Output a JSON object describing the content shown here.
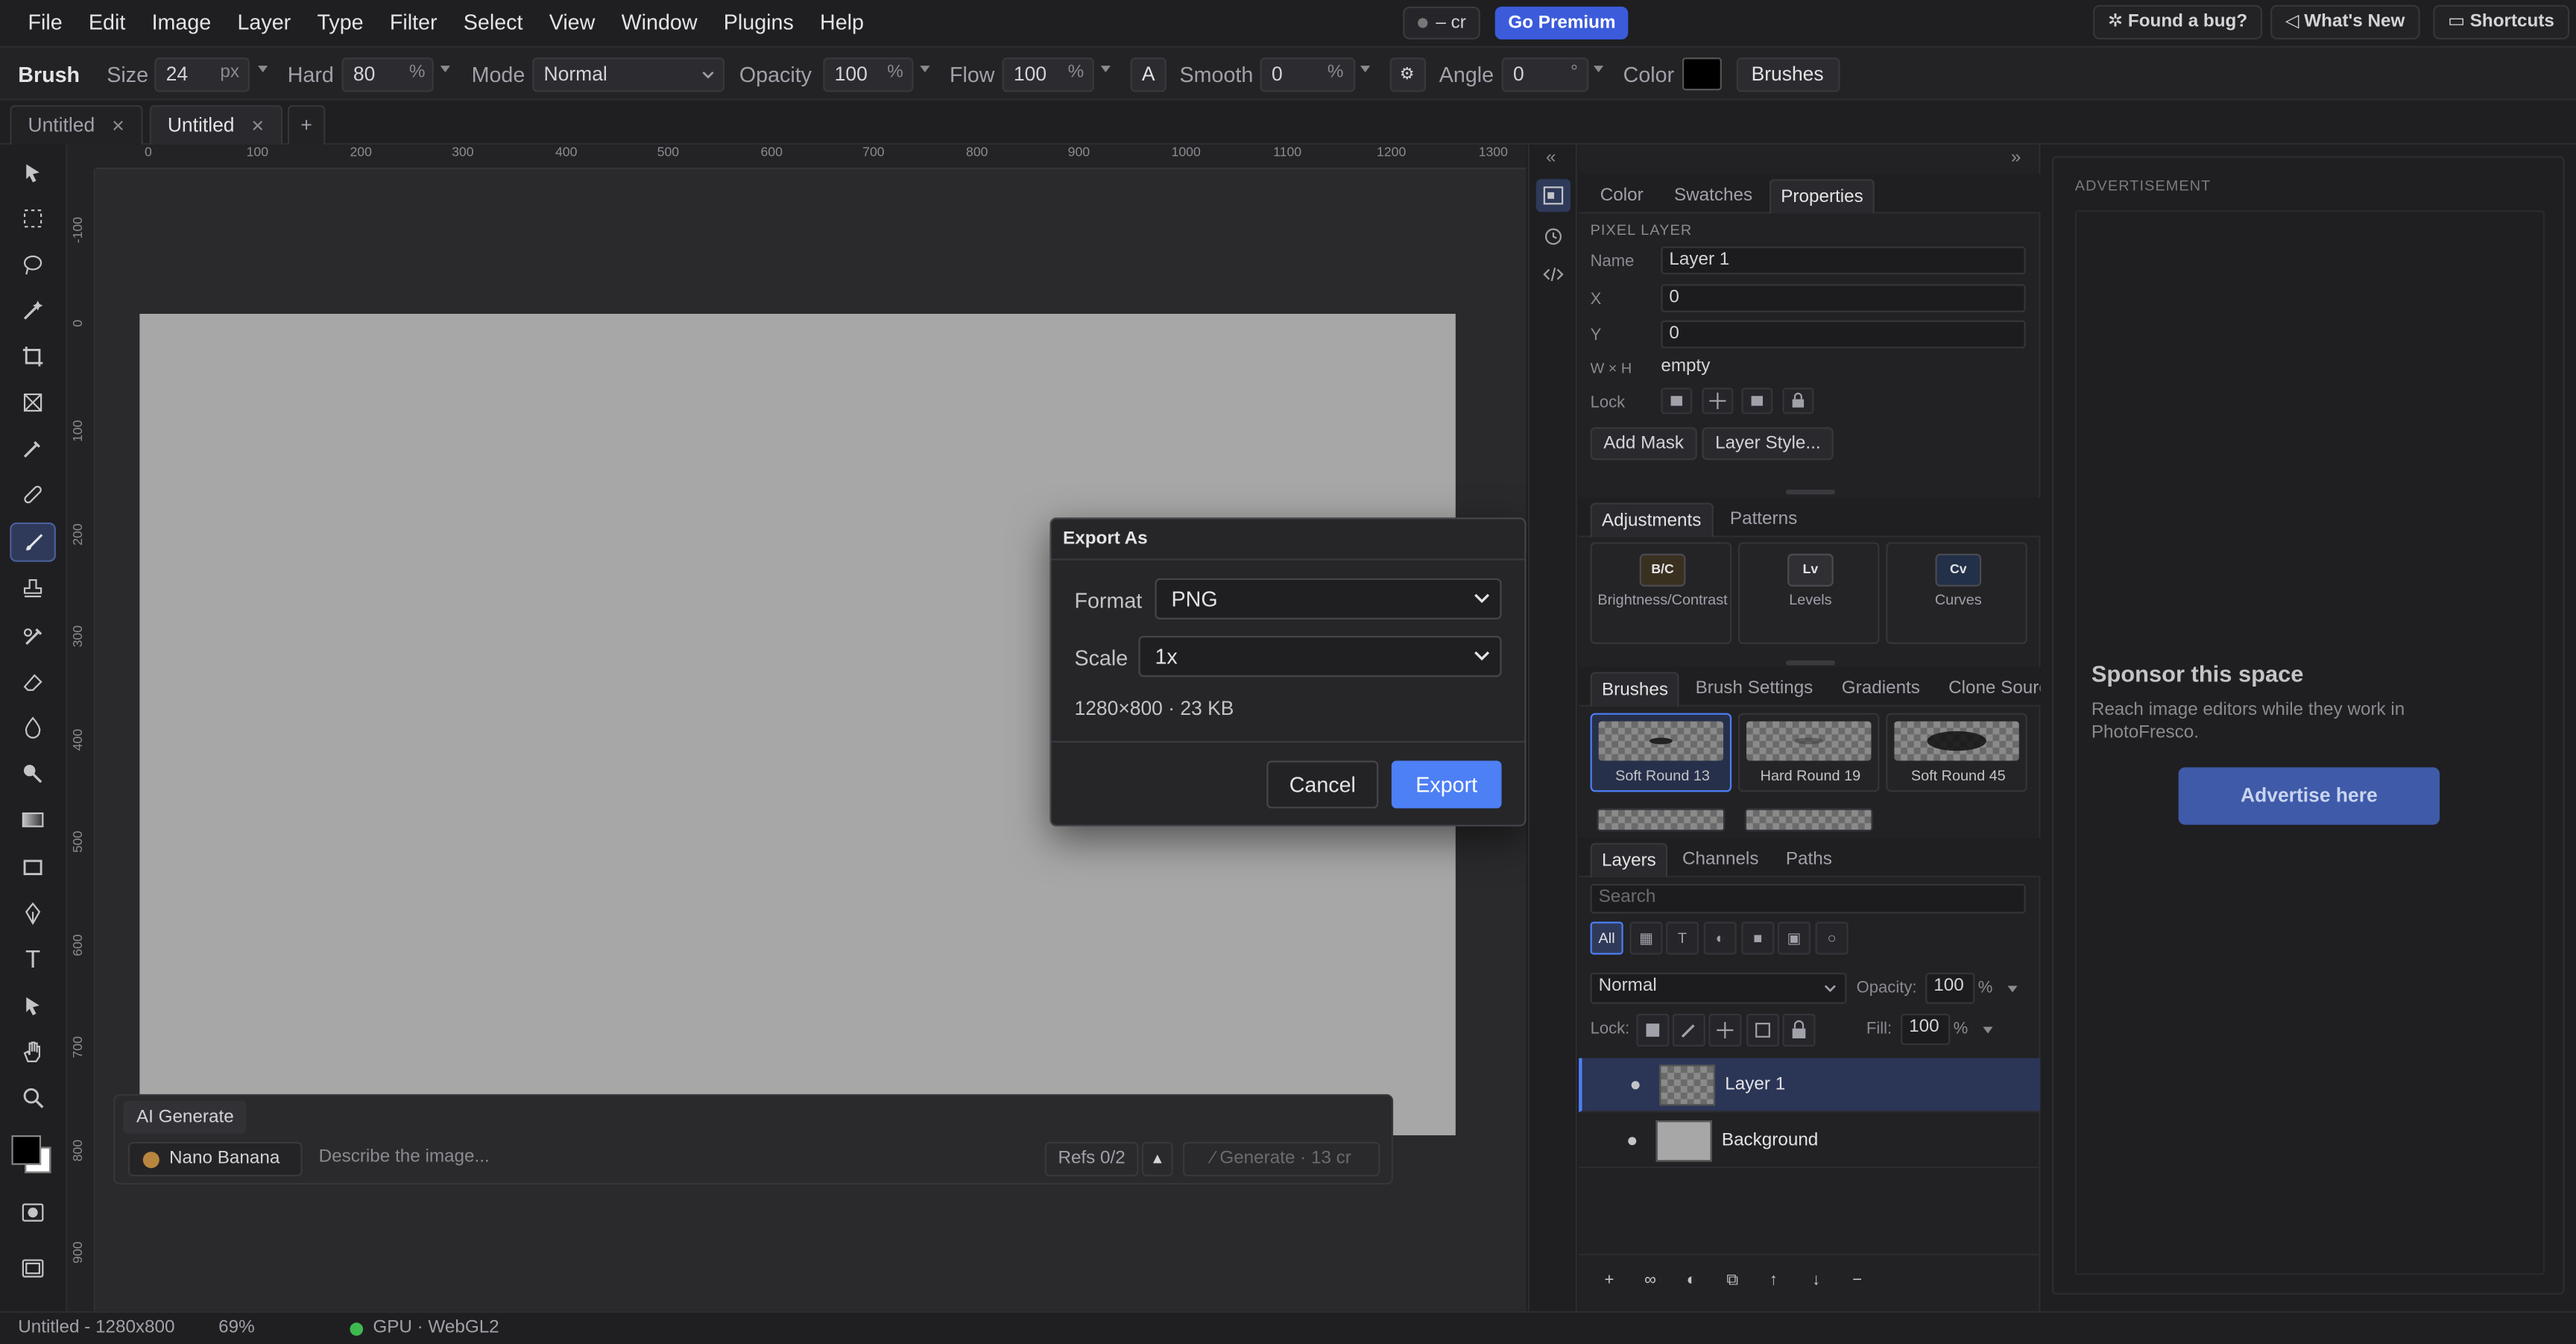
{
  "menu": [
    "File",
    "Edit",
    "Image",
    "Layer",
    "Type",
    "Filter",
    "Select",
    "View",
    "Window",
    "Plugins",
    "Help"
  ],
  "topbar": {
    "credits": "– cr",
    "premium": "Go Premium",
    "bug": "Found a bug?",
    "whats_new": "What's New",
    "shortcuts": "Shortcuts"
  },
  "options": {
    "tool": "Brush",
    "size_label": "Size",
    "size_value": "24",
    "size_unit": "px",
    "hard_label": "Hard",
    "hard_value": "80",
    "hard_unit": "%",
    "mode_label": "Mode",
    "mode_value": "Normal",
    "opacity_label": "Opacity",
    "opacity_value": "100",
    "opacity_unit": "%",
    "flow_label": "Flow",
    "flow_value": "100",
    "flow_unit": "%",
    "airbrush": "A",
    "smooth_label": "Smooth",
    "smooth_value": "0",
    "smooth_unit": "%",
    "angle_label": "Angle",
    "angle_value": "0",
    "angle_unit": "°",
    "color_label": "Color",
    "color_value": "#000000",
    "brushes_button": "Brushes"
  },
  "doc_tabs": [
    {
      "label": "Untitled"
    },
    {
      "label": "Untitled"
    }
  ],
  "new_tab": "+",
  "rulers": {
    "h": [
      "0",
      "100",
      "200",
      "300",
      "400",
      "500",
      "600",
      "700",
      "800",
      "900",
      "1000",
      "1100",
      "1200",
      "1300"
    ],
    "v": [
      "-100",
      "0",
      "100",
      "200",
      "300",
      "400",
      "500",
      "600",
      "700",
      "800",
      "900"
    ]
  },
  "ai": {
    "tab": "AI Generate",
    "model": "Nano Banana",
    "placeholder": "Describe the image...",
    "refs": "Refs 0/2",
    "up": "▲",
    "generate": "Generate · 13 cr"
  },
  "dialog": {
    "title": "Export As",
    "format_label": "Format",
    "format_value": "PNG",
    "scale_label": "Scale",
    "scale_value": "1x",
    "info": "1280×800 · 23 KB",
    "cancel": "Cancel",
    "export": "Export"
  },
  "panel": {
    "collapse_left": "«",
    "collapse_right": "»",
    "tabs1": [
      "Color",
      "Swatches",
      "Properties"
    ],
    "section": "PIXEL LAYER",
    "name_label": "Name",
    "name_value": "Layer 1",
    "x_label": "X",
    "x_value": "0",
    "y_label": "Y",
    "y_value": "0",
    "wh_label": "W × H",
    "wh_value": "empty",
    "lock_label": "Lock",
    "add_mask": "Add Mask",
    "layer_style": "Layer Style...",
    "tabs2": [
      "Adjustments",
      "Patterns"
    ],
    "adjustments": [
      {
        "icon": "B/C",
        "name": "Brightness/Contrast"
      },
      {
        "icon": "Lv",
        "name": "Levels"
      },
      {
        "icon": "Cv",
        "name": "Curves"
      }
    ],
    "tabs3": [
      "Brushes",
      "Brush Settings",
      "Gradients",
      "Clone Source"
    ],
    "brushes": [
      "Soft Round 13",
      "Hard Round 19",
      "Soft Round 45"
    ],
    "tabs4": [
      "Layers",
      "Channels",
      "Paths"
    ],
    "search_placeholder": "Search",
    "filters": [
      "All",
      "▦",
      "T",
      "◐",
      "■",
      "▣",
      "○"
    ],
    "blend": "Normal",
    "opacity_label": "Opacity:",
    "opacity_value": "100",
    "opacity_unit": "%",
    "lock_label2": "Lock:",
    "fill_label": "Fill:",
    "fill_value": "100",
    "fill_unit": "%",
    "layers": [
      {
        "name": "Layer 1"
      },
      {
        "name": "Background"
      }
    ]
  },
  "ad": {
    "label": "ADVERTISEMENT",
    "title": "Sponsor this space",
    "text": "Reach image editors while they work in PhotoFresco.",
    "button": "Advertise here"
  },
  "status": {
    "doc": "Untitled - 1280x800",
    "zoom": "69%",
    "gpu": "GPU · WebGL2"
  }
}
